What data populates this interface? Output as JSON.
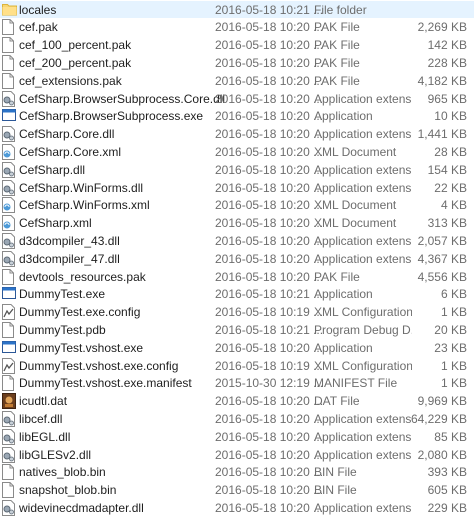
{
  "files": [
    {
      "name": "locales",
      "date": "2016-05-18 10:21 ...",
      "type": "File folder",
      "size": "",
      "icon": "folder-icon"
    },
    {
      "name": "cef.pak",
      "date": "2016-05-18 10:20 ...",
      "type": "PAK File",
      "size": "2,269 KB",
      "icon": "file-icon"
    },
    {
      "name": "cef_100_percent.pak",
      "date": "2016-05-18 10:20 ...",
      "type": "PAK File",
      "size": "142 KB",
      "icon": "file-icon"
    },
    {
      "name": "cef_200_percent.pak",
      "date": "2016-05-18 10:20 ...",
      "type": "PAK File",
      "size": "228 KB",
      "icon": "file-icon"
    },
    {
      "name": "cef_extensions.pak",
      "date": "2016-05-18 10:20 ...",
      "type": "PAK File",
      "size": "4,182 KB",
      "icon": "file-icon"
    },
    {
      "name": "CefSharp.BrowserSubprocess.Core.dll",
      "date": "2016-05-18 10:20 ...",
      "type": "Application extens...",
      "size": "965 KB",
      "icon": "dll-icon"
    },
    {
      "name": "CefSharp.BrowserSubprocess.exe",
      "date": "2016-05-18 10:20 ...",
      "type": "Application",
      "size": "10 KB",
      "icon": "exe-icon"
    },
    {
      "name": "CefSharp.Core.dll",
      "date": "2016-05-18 10:20 ...",
      "type": "Application extens...",
      "size": "1,441 KB",
      "icon": "dll-icon"
    },
    {
      "name": "CefSharp.Core.xml",
      "date": "2016-05-18 10:20 ...",
      "type": "XML Document",
      "size": "28 KB",
      "icon": "xml-icon"
    },
    {
      "name": "CefSharp.dll",
      "date": "2016-05-18 10:20 ...",
      "type": "Application extens...",
      "size": "154 KB",
      "icon": "dll-icon"
    },
    {
      "name": "CefSharp.WinForms.dll",
      "date": "2016-05-18 10:20 ...",
      "type": "Application extens...",
      "size": "22 KB",
      "icon": "dll-icon"
    },
    {
      "name": "CefSharp.WinForms.xml",
      "date": "2016-05-18 10:20 ...",
      "type": "XML Document",
      "size": "4 KB",
      "icon": "xml-icon"
    },
    {
      "name": "CefSharp.xml",
      "date": "2016-05-18 10:20 ...",
      "type": "XML Document",
      "size": "313 KB",
      "icon": "xml-icon"
    },
    {
      "name": "d3dcompiler_43.dll",
      "date": "2016-05-18 10:20 ...",
      "type": "Application extens...",
      "size": "2,057 KB",
      "icon": "dll-icon"
    },
    {
      "name": "d3dcompiler_47.dll",
      "date": "2016-05-18 10:20 ...",
      "type": "Application extens...",
      "size": "4,367 KB",
      "icon": "dll-icon"
    },
    {
      "name": "devtools_resources.pak",
      "date": "2016-05-18 10:20 ...",
      "type": "PAK File",
      "size": "4,556 KB",
      "icon": "file-icon"
    },
    {
      "name": "DummyTest.exe",
      "date": "2016-05-18 10:21 ...",
      "type": "Application",
      "size": "6 KB",
      "icon": "exe-icon"
    },
    {
      "name": "DummyTest.exe.config",
      "date": "2016-05-18 10:19 ...",
      "type": "XML Configuration...",
      "size": "1 KB",
      "icon": "config-icon"
    },
    {
      "name": "DummyTest.pdb",
      "date": "2016-05-18 10:21 ...",
      "type": "Program Debug D...",
      "size": "20 KB",
      "icon": "file-icon"
    },
    {
      "name": "DummyTest.vshost.exe",
      "date": "2016-05-18 10:20 ...",
      "type": "Application",
      "size": "23 KB",
      "icon": "exe-icon"
    },
    {
      "name": "DummyTest.vshost.exe.config",
      "date": "2016-05-18 10:19 ...",
      "type": "XML Configuration...",
      "size": "1 KB",
      "icon": "config-icon"
    },
    {
      "name": "DummyTest.vshost.exe.manifest",
      "date": "2015-10-30 12:19 ...",
      "type": "MANIFEST File",
      "size": "1 KB",
      "icon": "file-icon"
    },
    {
      "name": "icudtl.dat",
      "date": "2016-05-18 10:20 ...",
      "type": "DAT File",
      "size": "9,969 KB",
      "icon": "dat-icon"
    },
    {
      "name": "libcef.dll",
      "date": "2016-05-18 10:20 ...",
      "type": "Application extens...",
      "size": "64,229 KB",
      "icon": "dll-icon"
    },
    {
      "name": "libEGL.dll",
      "date": "2016-05-18 10:20 ...",
      "type": "Application extens...",
      "size": "85 KB",
      "icon": "dll-icon"
    },
    {
      "name": "libGLESv2.dll",
      "date": "2016-05-18 10:20 ...",
      "type": "Application extens...",
      "size": "2,080 KB",
      "icon": "dll-icon"
    },
    {
      "name": "natives_blob.bin",
      "date": "2016-05-18 10:20 ...",
      "type": "BIN File",
      "size": "393 KB",
      "icon": "file-icon"
    },
    {
      "name": "snapshot_blob.bin",
      "date": "2016-05-18 10:20 ...",
      "type": "BIN File",
      "size": "605 KB",
      "icon": "file-icon"
    },
    {
      "name": "widevinecdmadapter.dll",
      "date": "2016-05-18 10:20 ...",
      "type": "Application extens...",
      "size": "229 KB",
      "icon": "dll-icon"
    }
  ]
}
